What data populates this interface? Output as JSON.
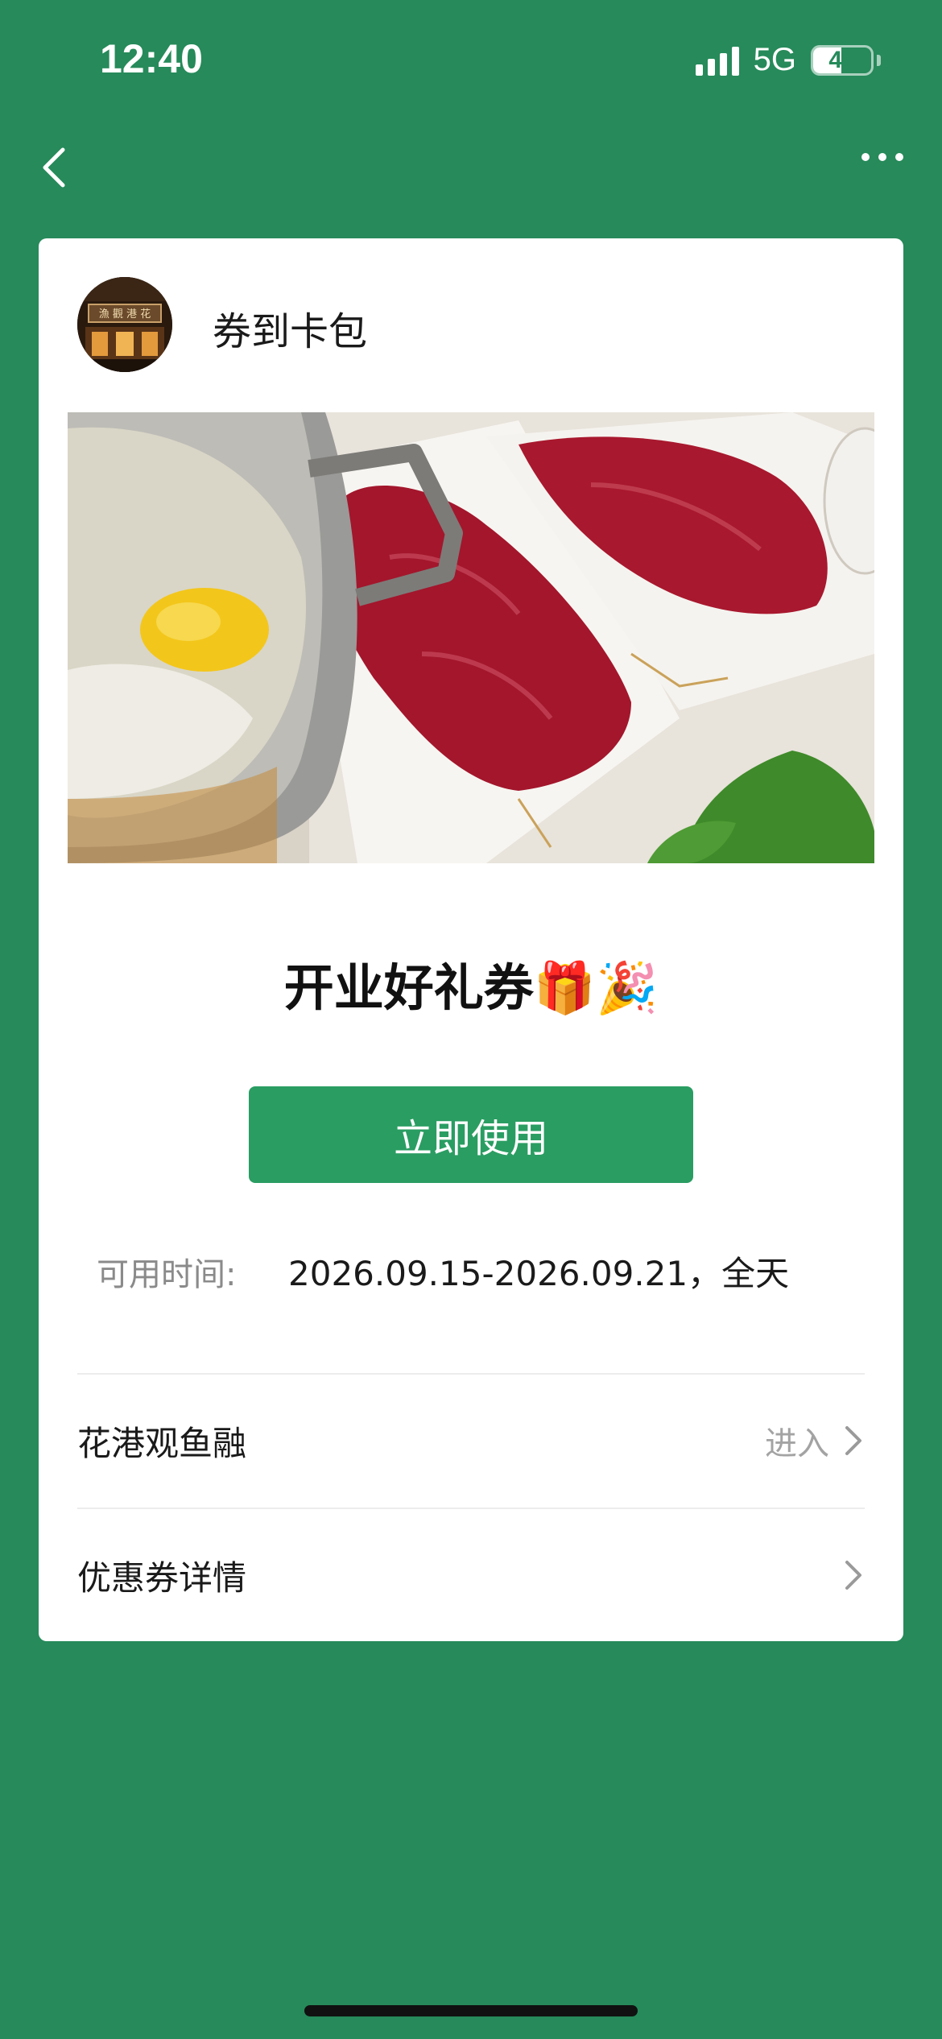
{
  "status_bar": {
    "time": "12:40",
    "network": "5G",
    "battery": "49",
    "battery_level": 0.49
  },
  "nav": {
    "back_icon": "chevron-left-icon",
    "more_icon": "more-dots-icon"
  },
  "card": {
    "brand_name": "券到卡包",
    "coupon_title": "开业好礼券🎁🎉",
    "use_button": "立即使用",
    "time_label": "可用时间:",
    "time_value": "2026.09.15-2026.09.21，全天",
    "rows": [
      {
        "label": "花港观鱼融",
        "action": "进入"
      },
      {
        "label": "优惠券详情",
        "action": ""
      }
    ]
  },
  "colors": {
    "background": "#268a5a",
    "button": "#2a9d62"
  }
}
